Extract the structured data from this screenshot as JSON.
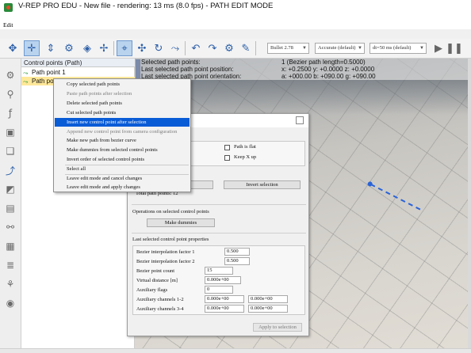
{
  "window": {
    "title": "V-REP PRO EDU - New file - rendering: 13 ms (8.0 fps) - PATH EDIT MODE",
    "menu_edit": "Edit"
  },
  "toolbar": {
    "buttons": [
      "move-arrows-icon",
      "translate-icon",
      "rotate-icon",
      "camera-fit-icon",
      "camera-rotate-icon",
      "camera-shift-icon",
      "camera-zoom-icon",
      "camera-angle-icon",
      "click-select-icon",
      "object-shift-icon",
      "object-rotate-icon",
      "assemble-icon",
      "transfer-dna-icon",
      "undo-icon",
      "redo-icon",
      "engine-icon"
    ],
    "engine_combo": "Bullet 2.78",
    "accuracy_combo": "Accurate (default)",
    "timestep_combo": "dt=50 ms (default)"
  },
  "hierarchy": {
    "header": "Control points (Path)",
    "items": [
      {
        "label": "Path point 1",
        "selected": false
      },
      {
        "label": "Path point 2",
        "selected": true
      }
    ]
  },
  "scene_info": {
    "line1_left": "Selected path points:",
    "line1_right": "1 (Bezier path length=0.5000)",
    "line2_left": "Last selected path point position:",
    "line2_right": "x: +0.2500   y: +0.0000   z: +0.0000",
    "line3_left": "Last selected path point orientation:",
    "line3_right": "a: +000.00   b: +090.00   g: +090.00"
  },
  "context_menu": {
    "items": [
      {
        "label": "Copy selected path points",
        "enabled": true
      },
      {
        "label": "Paste path points after selection",
        "enabled": false
      },
      {
        "label": "Delete selected path points",
        "enabled": true
      },
      {
        "label": "Cut selected path points",
        "enabled": true
      },
      {
        "label": "Insert new control point after selection",
        "enabled": true,
        "highlighted": true
      },
      {
        "label": "Append new control point from camera configuration",
        "enabled": false
      },
      {
        "label": "Make new path from bezier curve",
        "enabled": true
      },
      {
        "label": "Make dummies from selected control points",
        "enabled": true
      },
      {
        "label": "Invert order of selected control points",
        "enabled": true
      },
      {
        "label": "Select all",
        "enabled": true,
        "separator_before": true
      },
      {
        "label": "Leave edit mode and cancel changes",
        "enabled": true,
        "separator_before": true
      },
      {
        "label": "Leave edit mode and apply changes",
        "enabled": true
      }
    ]
  },
  "dialog": {
    "path_is_flat_label": "Path is flat",
    "keep_x_up_label": "Keep X up",
    "invert_selection_label": "Invert selection",
    "total_path_points": "Total path points: 12",
    "ops_title": "Operations on selected control points",
    "make_dummies_label": "Make dummies",
    "props_title": "Last selected control point properties",
    "fields": [
      {
        "label": "Bezier interpolation factor 1",
        "value": "0.500"
      },
      {
        "label": "Bezier interpolation factor 2",
        "value": "0.500"
      },
      {
        "label": "Bezier point count",
        "value": "15"
      },
      {
        "label": "Virtual distance [m]",
        "value": "0.000e+00"
      },
      {
        "label": "Auxiliary flags",
        "value": "0"
      },
      {
        "label": "Auxiliary channels 1-2",
        "value": "0.000e+00",
        "value2": "0.000e+00"
      },
      {
        "label": "Auxiliary channels 3-4",
        "value": "0.000e+00",
        "value2": "0.000e+00"
      }
    ],
    "apply_label": "Apply to selection"
  }
}
